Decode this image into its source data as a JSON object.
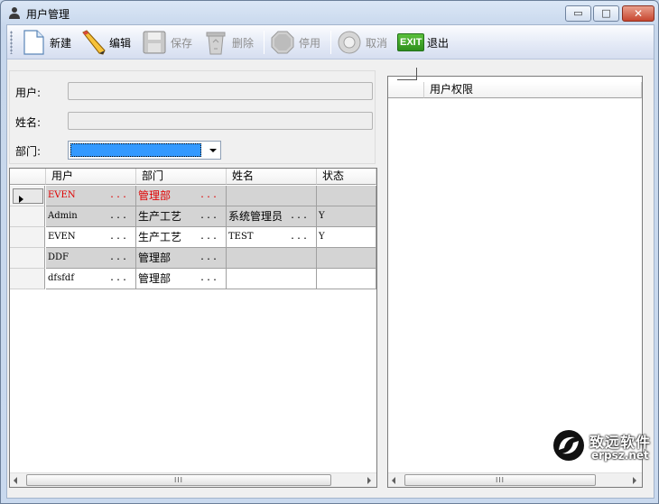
{
  "window": {
    "title": "用户管理"
  },
  "toolbar": {
    "new_label": "新建",
    "edit_label": "编辑",
    "save_label": "保存",
    "delete_label": "删除",
    "disable_label": "停用",
    "cancel_label": "取消",
    "exit_icon_text": "EXIT",
    "exit_label": "退出"
  },
  "form": {
    "user_label": "用户:",
    "user_value": "",
    "name_label": "姓名:",
    "name_value": "",
    "dept_label": "部门:",
    "dept_value": ""
  },
  "users_grid": {
    "columns": [
      "用户",
      "部门",
      "姓名",
      "状态"
    ],
    "rows": [
      {
        "user": "EVEN",
        "dept": "管理部",
        "name": "",
        "status": "",
        "selected": true
      },
      {
        "user": "Admin",
        "dept": "生产工艺",
        "name": "系统管理员",
        "status": "Y"
      },
      {
        "user": "EVEN",
        "dept": "生产工艺",
        "name": "TEST",
        "status": "Y"
      },
      {
        "user": "DDF",
        "dept": "管理部",
        "name": "",
        "status": ""
      },
      {
        "user": "dfsfdf",
        "dept": "管理部",
        "name": "",
        "status": ""
      }
    ],
    "ellipsis": "...",
    "scroll_grip": "III"
  },
  "perm_grid": {
    "column": "用户权限",
    "scroll_grip": "III"
  },
  "watermark": {
    "name": "致远软件",
    "url": "erpsz.net"
  },
  "colors": {
    "selected_text": "#e00000",
    "dark_row": "#d4d4d4",
    "selection_blue": "#3399ff"
  }
}
